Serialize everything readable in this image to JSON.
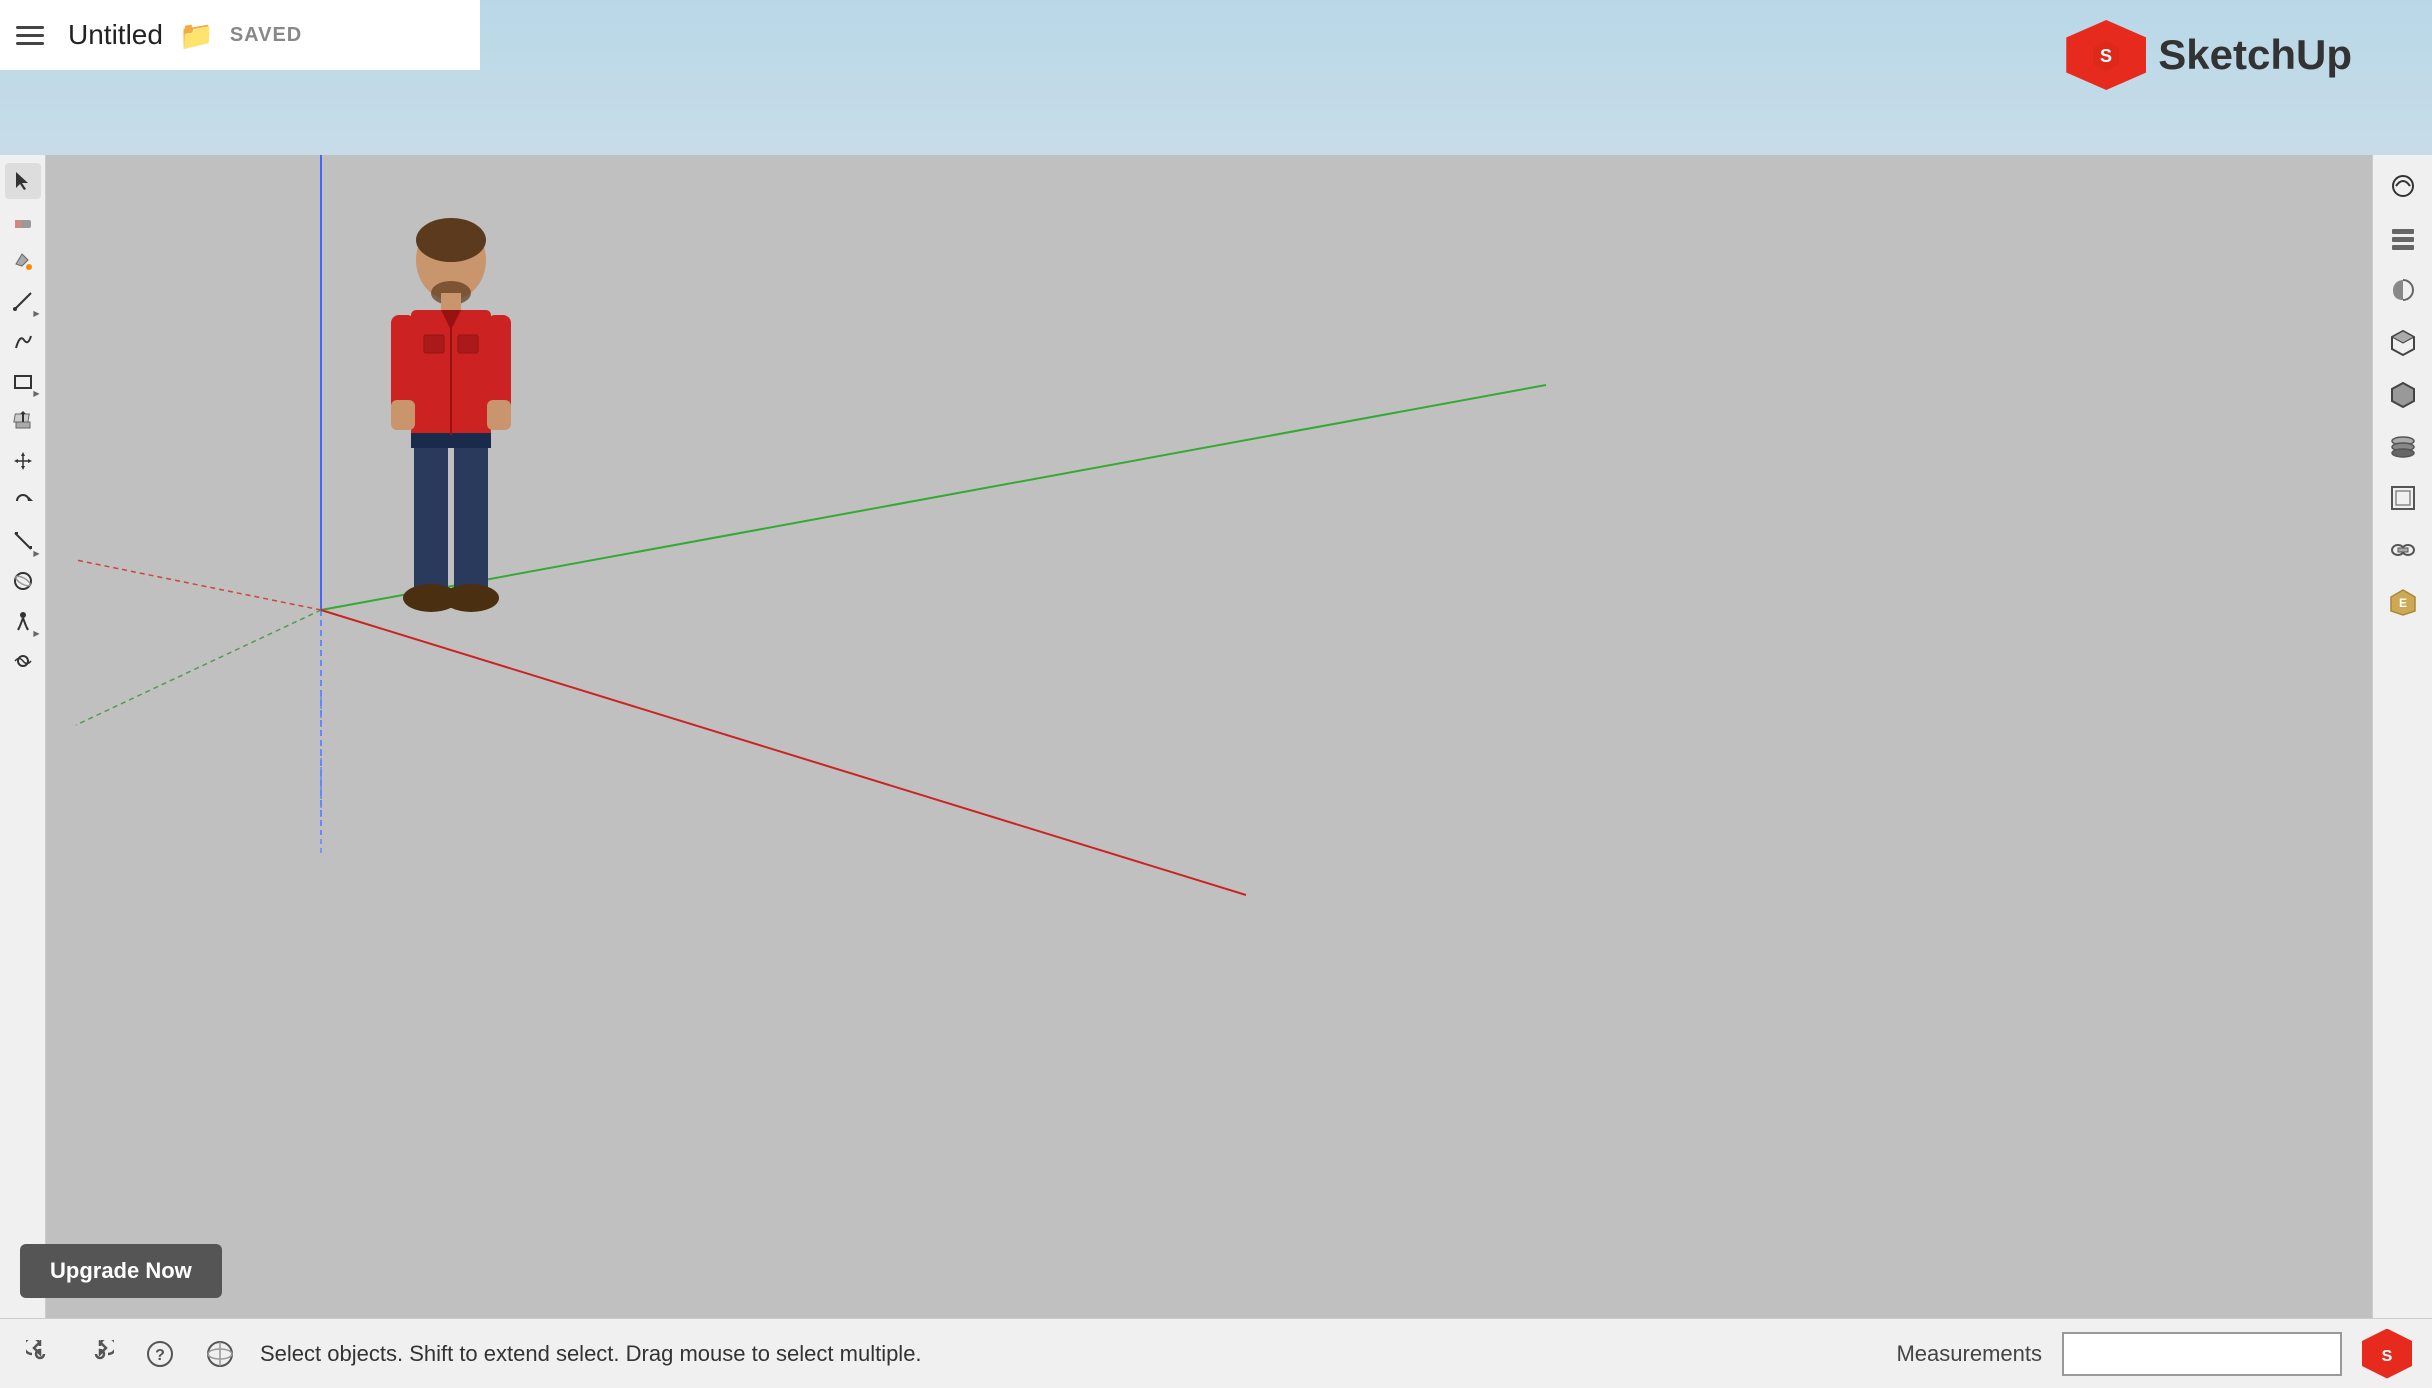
{
  "titlebar": {
    "title": "Untitled",
    "saved_status": "SAVED"
  },
  "logo": {
    "text": "SketchUp"
  },
  "left_toolbar": {
    "tools": [
      {
        "name": "select",
        "icon": "↖",
        "label": "Select Tool",
        "has_arrow": false
      },
      {
        "name": "eraser",
        "icon": "◈",
        "label": "Eraser Tool",
        "has_arrow": false
      },
      {
        "name": "paint-bucket",
        "icon": "◉",
        "label": "Paint Bucket",
        "has_arrow": false
      },
      {
        "name": "line",
        "icon": "✏",
        "label": "Line Tool",
        "has_arrow": true
      },
      {
        "name": "freehand",
        "icon": "✒",
        "label": "Freehand Tool",
        "has_arrow": false
      },
      {
        "name": "rectangle",
        "icon": "▭",
        "label": "Rectangle Tool",
        "has_arrow": true
      },
      {
        "name": "push-pull",
        "icon": "⬡",
        "label": "Push Pull",
        "has_arrow": false
      },
      {
        "name": "move",
        "icon": "✛",
        "label": "Move Tool",
        "has_arrow": false
      },
      {
        "name": "rotate",
        "icon": "⟳",
        "label": "Rotate Tool",
        "has_arrow": false
      },
      {
        "name": "tape-measure",
        "icon": "📐",
        "label": "Tape Measure",
        "has_arrow": true
      },
      {
        "name": "orbit",
        "icon": "⊕",
        "label": "Orbit Tool",
        "has_arrow": false
      },
      {
        "name": "walk",
        "icon": "◎",
        "label": "Walk Tool",
        "has_arrow": true
      },
      {
        "name": "look-around",
        "icon": "◑",
        "label": "Look Around",
        "has_arrow": false
      }
    ]
  },
  "right_toolbar": {
    "tools": [
      {
        "name": "styles",
        "icon": "◫",
        "label": "Styles"
      },
      {
        "name": "scenes",
        "icon": "▤",
        "label": "Scenes"
      },
      {
        "name": "shadows",
        "icon": "◩",
        "label": "Shadows"
      },
      {
        "name": "components",
        "icon": "⬡",
        "label": "Components"
      },
      {
        "name": "solid-tools",
        "icon": "⬢",
        "label": "Solid Tools"
      },
      {
        "name": "layers",
        "icon": "◫",
        "label": "Layers"
      },
      {
        "name": "model-info",
        "icon": "◻",
        "label": "Model Info"
      },
      {
        "name": "vr",
        "icon": "◎",
        "label": "VR"
      },
      {
        "name": "extension",
        "icon": "◺",
        "label": "Extension"
      }
    ]
  },
  "statusbar": {
    "status_text": "Select objects. Shift to extend select. Drag mouse to select multiple.",
    "measurements_label": "Measurements",
    "undo_icon": "↩",
    "redo_icon": "↪",
    "help_icon": "?",
    "earth_icon": "🌐"
  },
  "upgrade": {
    "button_label": "Upgrade Now"
  }
}
